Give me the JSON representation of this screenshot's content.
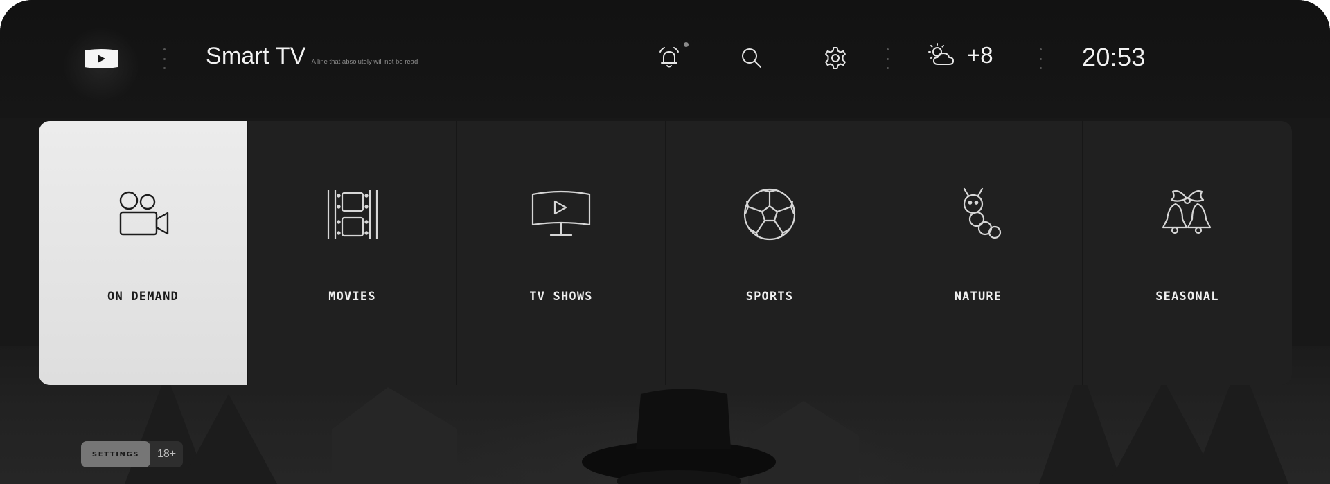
{
  "header": {
    "app_title": "Smart TV",
    "subtitle": "A line that absolutely will not be read",
    "temperature": "+8",
    "time": "20:53",
    "icons": {
      "logo": "play-logo-icon",
      "notifications": "alarm-bell-icon",
      "search": "search-icon",
      "settings": "gear-icon",
      "weather": "partly-cloudy-icon"
    }
  },
  "categories": [
    {
      "label": "ON DEMAND",
      "icon": "video-camera-icon",
      "active": true
    },
    {
      "label": "MOVIES",
      "icon": "film-strip-icon",
      "active": false
    },
    {
      "label": "TV SHOWS",
      "icon": "tv-play-icon",
      "active": false
    },
    {
      "label": "SPORTS",
      "icon": "soccer-ball-icon",
      "active": false
    },
    {
      "label": "NATURE",
      "icon": "caterpillar-icon",
      "active": false
    },
    {
      "label": "SEASONAL",
      "icon": "christmas-bells-icon",
      "active": false
    }
  ],
  "featured": {
    "settings_badge": "SETTINGS",
    "age_rating": "18+"
  },
  "colors": {
    "background": "#181818",
    "active_tile": "#e6e6e6",
    "tile": "#202020",
    "text": "#f0f0f0"
  }
}
